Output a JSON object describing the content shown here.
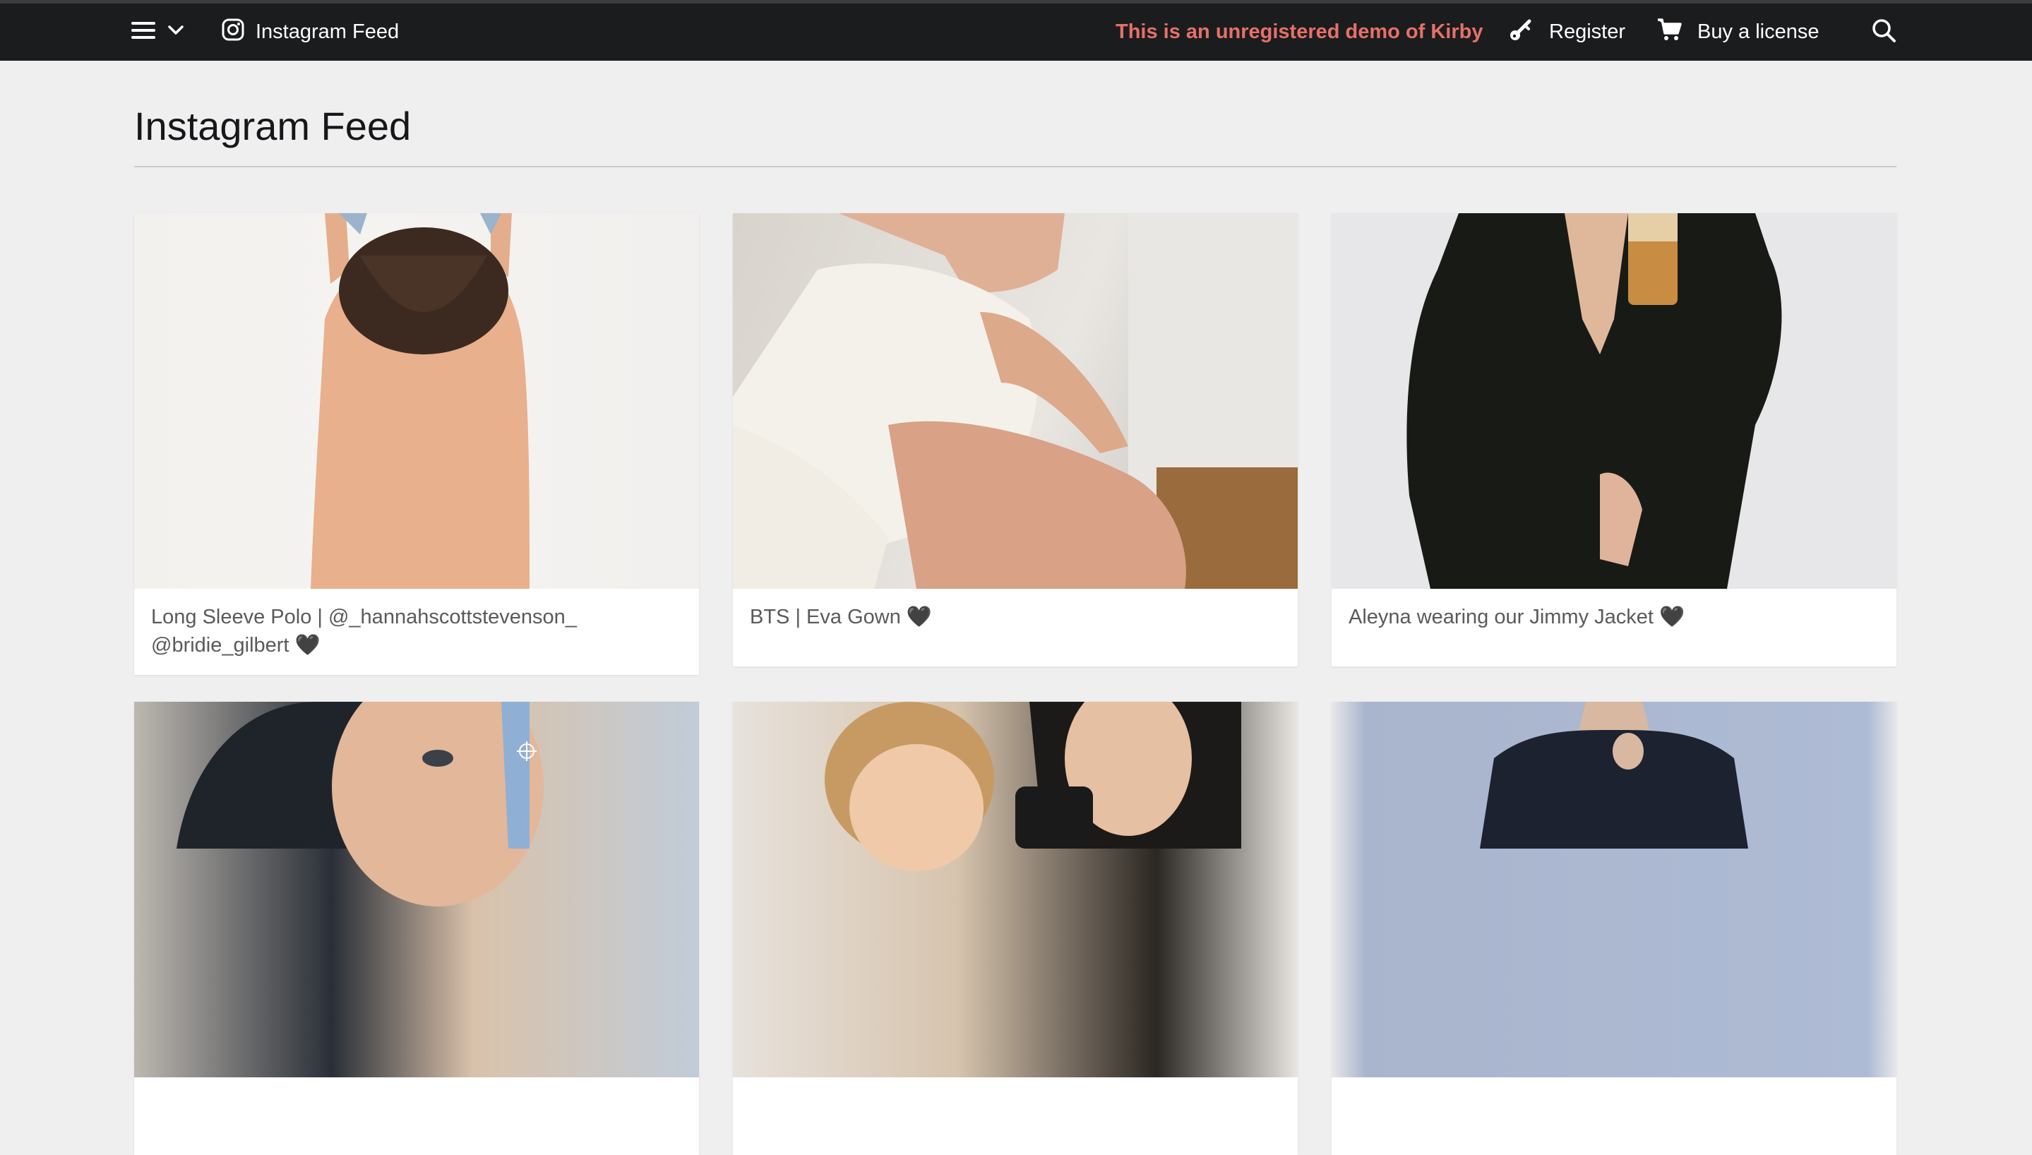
{
  "topbar": {
    "breadcrumb_label": "Instagram Feed",
    "demo_notice": "This is an unregistered demo of Kirby",
    "register_label": "Register",
    "buy_label": "Buy a license"
  },
  "page": {
    "title": "Instagram Feed"
  },
  "cards": [
    {
      "caption": "Long Sleeve Polo | @_hannahscottstevenson_ @bridie_gilbert 🖤"
    },
    {
      "caption": "BTS | Eva Gown 🖤"
    },
    {
      "caption": "Aleyna wearing our Jimmy Jacket 🖤"
    },
    {
      "caption": ""
    },
    {
      "caption": ""
    },
    {
      "caption": ""
    }
  ],
  "icons": {
    "menu": "hamburger-icon",
    "dropdown": "chevron-down-icon",
    "instagram": "instagram-icon",
    "register": "key-icon",
    "buy": "cart-icon",
    "search": "search-icon"
  },
  "colors": {
    "topbar": "#1b1c1e",
    "demo_notice": "#e57168",
    "background": "#efefef"
  }
}
